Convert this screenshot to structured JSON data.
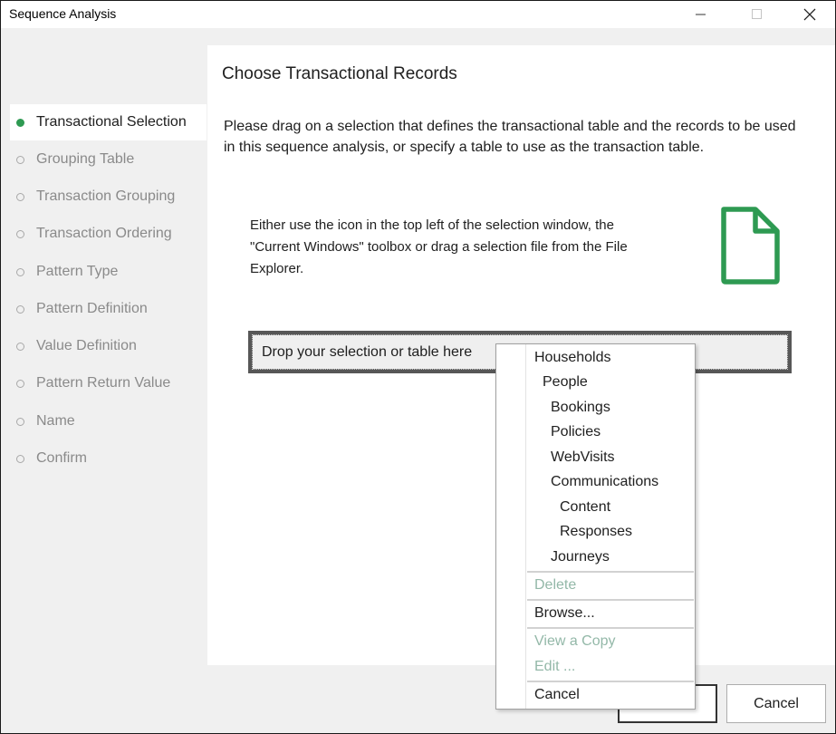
{
  "window": {
    "title": "Sequence Analysis"
  },
  "sidebar": {
    "items": [
      {
        "label": "Transactional Selection",
        "active": true
      },
      {
        "label": "Grouping Table"
      },
      {
        "label": "Transaction Grouping"
      },
      {
        "label": "Transaction Ordering"
      },
      {
        "label": "Pattern Type"
      },
      {
        "label": "Pattern Definition"
      },
      {
        "label": "Value Definition"
      },
      {
        "label": "Pattern Return Value"
      },
      {
        "label": "Name"
      },
      {
        "label": "Confirm"
      }
    ]
  },
  "main": {
    "title": "Choose Transactional Records",
    "instructions": "Please drag on a selection that defines the transactional table and the records to be used in this sequence analysis, or specify a table to use as the transaction table.",
    "hint_line1": "Either use the icon in the top left of the selection window, the",
    "hint_line2": "\"Current Windows\" toolbox or drag a selection file from the File",
    "hint_line3": "Explorer.",
    "file_icon": "document-icon",
    "dropzone_label": "Drop your selection or table here"
  },
  "context_menu": {
    "tables": [
      {
        "label": "Households",
        "level": 0
      },
      {
        "label": "People",
        "level": 1
      },
      {
        "label": "Bookings",
        "level": 2
      },
      {
        "label": "Policies",
        "level": 2
      },
      {
        "label": "WebVisits",
        "level": 2
      },
      {
        "label": "Communications",
        "level": 2
      },
      {
        "label": "Content",
        "level": 3
      },
      {
        "label": "Responses",
        "level": 3
      },
      {
        "label": "Journeys",
        "level": 2
      }
    ],
    "delete_label": "Delete",
    "browse_label": "Browse...",
    "view_copy_label": "View a Copy",
    "edit_label": "Edit ...",
    "cancel_label": "Cancel"
  },
  "footer": {
    "next_label": "",
    "cancel_label": "Cancel"
  },
  "colors": {
    "accent": "#2e9a52",
    "disabled_text": "#93b8a8"
  }
}
